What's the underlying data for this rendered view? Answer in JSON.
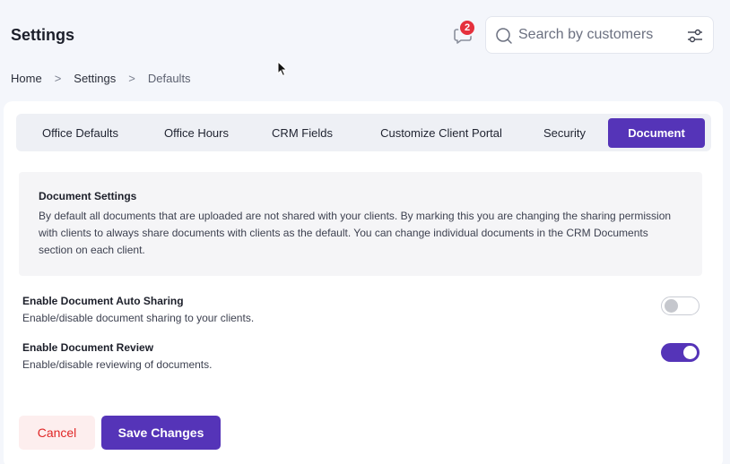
{
  "header": {
    "title": "Settings",
    "notification_count": "2",
    "search_placeholder": "Search by customers"
  },
  "breadcrumb": {
    "items": [
      "Home",
      "Settings",
      "Defaults"
    ],
    "separator": ">"
  },
  "tabs": [
    {
      "label": "Office Defaults",
      "active": false
    },
    {
      "label": "Office Hours",
      "active": false
    },
    {
      "label": "CRM Fields",
      "active": false
    },
    {
      "label": "Customize Client Portal",
      "active": false
    },
    {
      "label": "Security",
      "active": false
    },
    {
      "label": "Document",
      "active": true
    }
  ],
  "info": {
    "title": "Document Settings",
    "text": "By default all documents that are uploaded are not shared with your clients. By marking this you are changing the sharing permission with clients to always share documents with clients as the default. You can change individual documents in the CRM Documents section on each client."
  },
  "settings": [
    {
      "title": "Enable Document Auto Sharing",
      "description": "Enable/disable document sharing to your clients.",
      "enabled": false
    },
    {
      "title": "Enable Document Review",
      "description": "Enable/disable reviewing of documents.",
      "enabled": true
    }
  ],
  "actions": {
    "cancel_label": "Cancel",
    "save_label": "Save Changes"
  },
  "colors": {
    "accent": "#5534b8",
    "badge": "#e5303c",
    "cancel_text": "#e02626",
    "cancel_bg": "#fdeeee"
  },
  "icons": [
    "chat-bubble-icon",
    "search-icon",
    "filter-sliders-icon",
    "mouse-cursor-icon"
  ]
}
